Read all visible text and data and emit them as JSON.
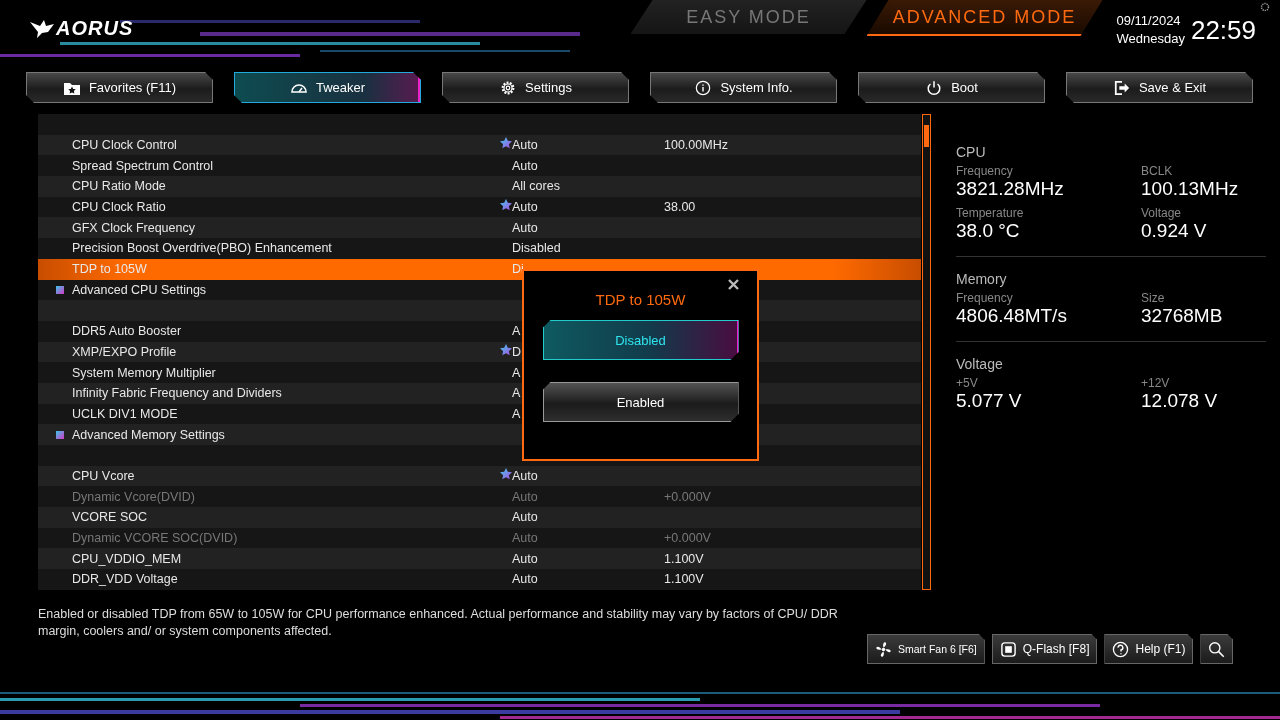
{
  "logo": "AORUS",
  "modes": [
    {
      "label": "EASY MODE",
      "selected": false
    },
    {
      "label": "ADVANCED MODE",
      "selected": true
    }
  ],
  "clock": {
    "date": "09/11/2024",
    "weekday": "Wednesday",
    "time": "22:59"
  },
  "tabs": [
    {
      "label": "Favorites (F11)",
      "selected": false
    },
    {
      "label": "Tweaker",
      "selected": true
    },
    {
      "label": "Settings",
      "selected": false
    },
    {
      "label": "System Info.",
      "selected": false
    },
    {
      "label": "Boot",
      "selected": false
    },
    {
      "label": "Save & Exit",
      "selected": false
    }
  ],
  "rows": [
    {
      "kind": "spacer"
    },
    {
      "kind": "setting",
      "label": "CPU Clock Control",
      "starred": true,
      "value": "Auto",
      "value_2": "100.00MHz",
      "disabled": false,
      "selected": false
    },
    {
      "kind": "setting",
      "label": "Spread Spectrum Control",
      "starred": false,
      "value": "Auto",
      "disabled": false,
      "selected": false
    },
    {
      "kind": "setting",
      "label": "CPU Ratio Mode",
      "starred": false,
      "value": "All cores",
      "disabled": false,
      "selected": false
    },
    {
      "kind": "setting",
      "label": "CPU Clock Ratio",
      "starred": true,
      "value": "Auto",
      "value_2": "38.00",
      "disabled": false,
      "selected": false
    },
    {
      "kind": "setting",
      "label": "GFX Clock Frequency",
      "starred": false,
      "value": "Auto",
      "disabled": false,
      "selected": false
    },
    {
      "kind": "setting",
      "label": "Precision Boost Overdrive(PBO) Enhancement",
      "starred": false,
      "value": "Disabled",
      "disabled": false,
      "selected": false
    },
    {
      "kind": "setting",
      "label": "TDP to 105W",
      "starred": false,
      "value": "Di",
      "disabled": false,
      "selected": true
    },
    {
      "kind": "submenu",
      "label": "Advanced CPU Settings",
      "selected": false
    },
    {
      "kind": "spacer"
    },
    {
      "kind": "setting",
      "label": "DDR5 Auto Booster",
      "starred": false,
      "value": "A",
      "disabled": false,
      "selected": false
    },
    {
      "kind": "setting",
      "label": "XMP/EXPO Profile",
      "starred": true,
      "value": "D",
      "disabled": false,
      "selected": false
    },
    {
      "kind": "setting",
      "label": "System Memory Multiplier",
      "starred": false,
      "value": "A",
      "disabled": false,
      "selected": false
    },
    {
      "kind": "setting",
      "label": "Infinity Fabric Frequency and Dividers",
      "starred": false,
      "value": "A",
      "disabled": false,
      "selected": false
    },
    {
      "kind": "setting",
      "label": "UCLK DIV1 MODE",
      "starred": false,
      "value": "A",
      "disabled": false,
      "selected": false
    },
    {
      "kind": "submenu",
      "label": "Advanced Memory Settings",
      "selected": false
    },
    {
      "kind": "spacer"
    },
    {
      "kind": "setting",
      "label": "CPU Vcore",
      "starred": true,
      "value": "Auto",
      "disabled": false,
      "selected": false
    },
    {
      "kind": "setting",
      "label": "Dynamic Vcore(DVID)",
      "starred": false,
      "value": "Auto",
      "value_2": "+0.000V",
      "disabled": true,
      "selected": false
    },
    {
      "kind": "setting",
      "label": "VCORE SOC",
      "starred": false,
      "value": "Auto",
      "disabled": false,
      "selected": false
    },
    {
      "kind": "setting",
      "label": "Dynamic VCORE SOC(DVID)",
      "starred": false,
      "value": "Auto",
      "value_2": "+0.000V",
      "disabled": true,
      "selected": false
    },
    {
      "kind": "setting",
      "label": "CPU_VDDIO_MEM",
      "starred": false,
      "value": "Auto",
      "value_2": "1.100V",
      "disabled": false,
      "selected": false
    },
    {
      "kind": "setting",
      "label": "DDR_VDD Voltage",
      "starred": false,
      "value": "Auto",
      "value_2": "1.100V",
      "disabled": false,
      "selected": false
    }
  ],
  "dialog": {
    "title": "TDP to 105W",
    "options": [
      {
        "label": "Disabled",
        "selected": true
      },
      {
        "label": "Enabled",
        "selected": false
      }
    ]
  },
  "monitor": [
    {
      "title": "CPU",
      "items": [
        {
          "label": "Frequency",
          "value": "3821.28MHz"
        },
        {
          "label": "BCLK",
          "value": "100.13MHz"
        },
        {
          "label": "Temperature",
          "value": "38.0 °C"
        },
        {
          "label": "Voltage",
          "value": "0.924 V"
        }
      ]
    },
    {
      "title": "Memory",
      "items": [
        {
          "label": "Frequency",
          "value": "4806.48MT/s"
        },
        {
          "label": "Size",
          "value": "32768MB"
        }
      ]
    },
    {
      "title": "Voltage",
      "items": [
        {
          "label": "+5V",
          "value": "5.077 V"
        },
        {
          "label": "+12V",
          "value": "12.078 V"
        }
      ]
    }
  ],
  "description": "Enabled or disabled TDP from 65W to 105W for CPU performance enhanced. Actual performance and stability may vary by factors of CPU/ DDR margin, coolers and/ or system components affected.",
  "bottom_buttons": [
    {
      "label": "Smart Fan 6 [F6]"
    },
    {
      "label": "Q-Flash [F8]"
    },
    {
      "label": "Help (F1)"
    }
  ]
}
